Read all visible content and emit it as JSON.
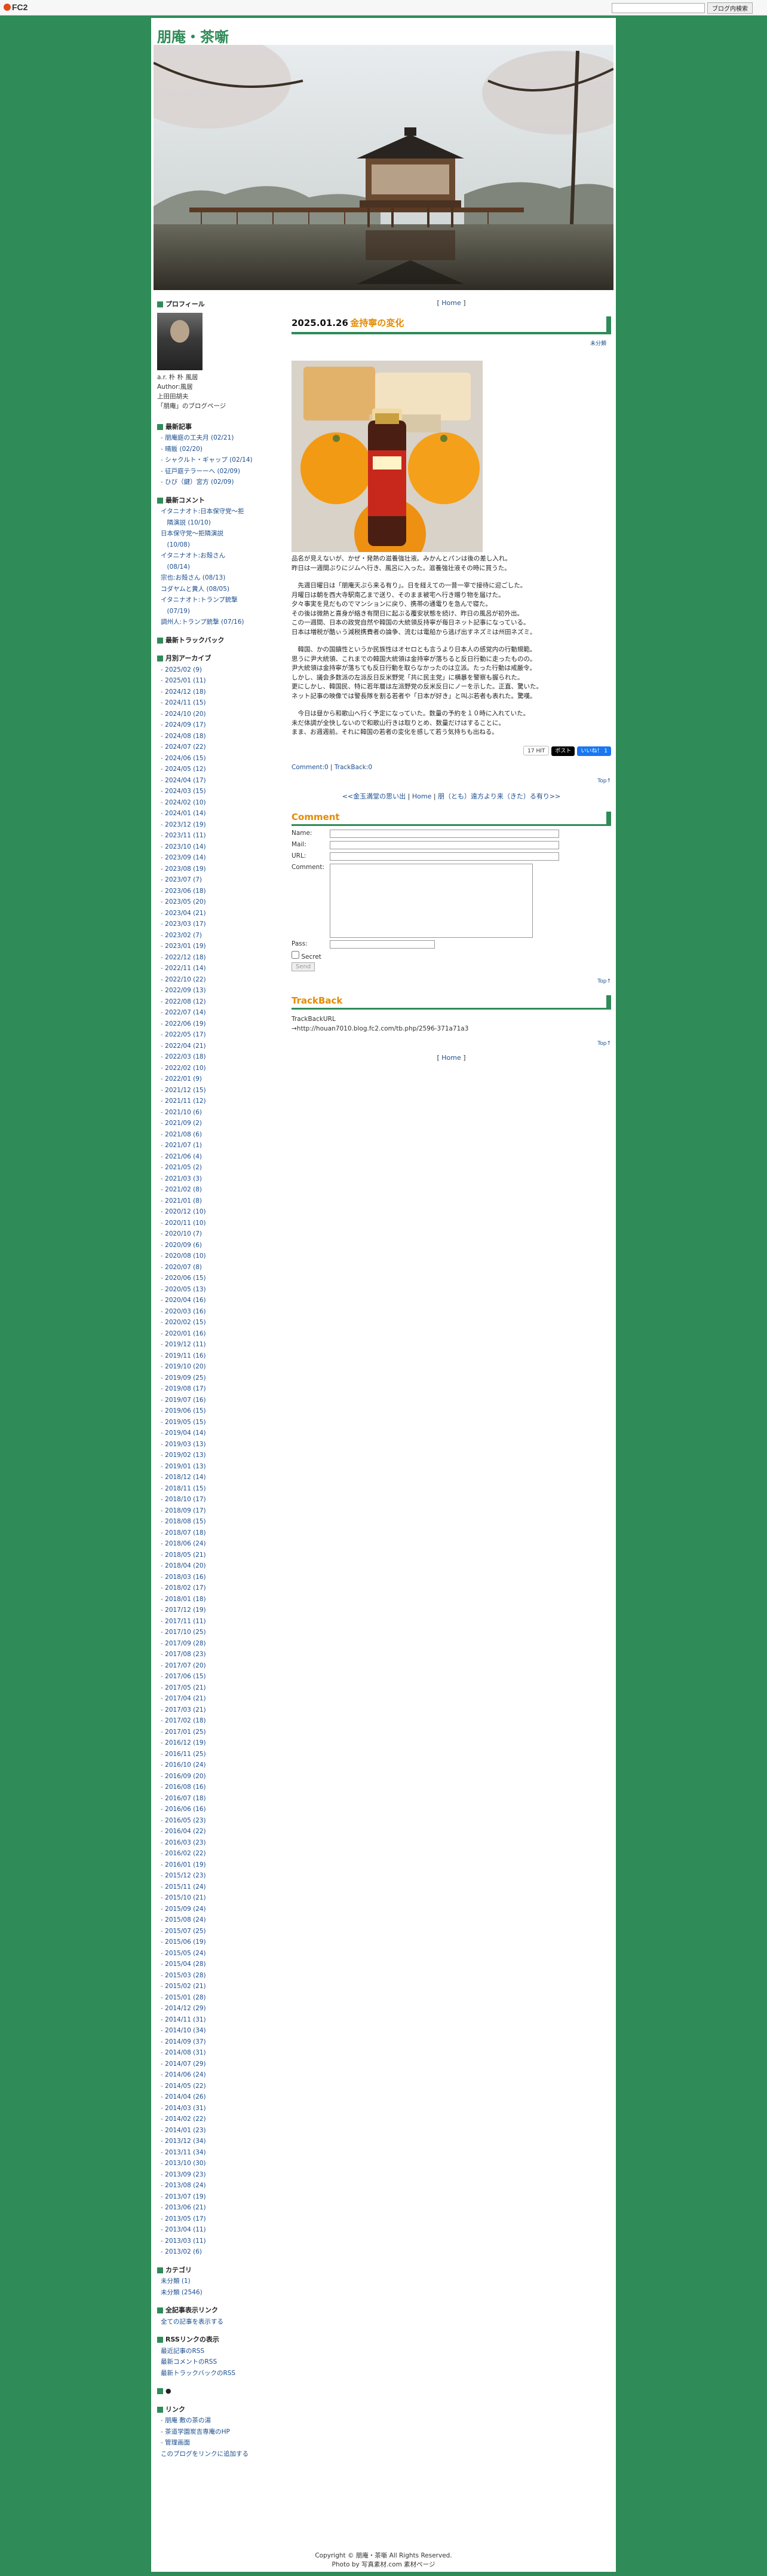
{
  "fc2bar": {
    "logo": "FC2",
    "search_button": "ブログ内検索"
  },
  "site": {
    "title": "朋庵・茶噺"
  },
  "sidebar": {
    "profile": {
      "heading": "プロフィール",
      "name": "a.r. 朴 朴 風居",
      "author": "Author:風居",
      "line1": "上田田胡夫",
      "line2": "「朋庵」のブログページ"
    },
    "recent_entries": {
      "heading": "最新記事",
      "items": [
        "朋庵庭の工夫月 (02/21)",
        "晴飯 (02/20)",
        "シャクルト・ギャップ (02/14)",
        "征戸庭テラーーへ (02/09)",
        "ひび（鍵）宮方 (02/09)"
      ]
    },
    "recent_comments": {
      "heading": "最新コメント",
      "items": [
        "イタニナオト:日本保守党～拒",
        "　隣演説 (10/10)",
        "日本保守党～拒隣演説",
        "　(10/08)",
        "イタニナオト:お殻さん",
        "　(08/14)",
        "宗也:お殻さん (08/13)",
        "コダヤムと黄人 (08/05)",
        "イタニナオト:トランプ銃撃",
        "　(07/19)",
        "調州人:トランプ銃撃 (07/16)"
      ]
    },
    "recent_trackback": {
      "heading": "最新トラックバック"
    },
    "archives": {
      "heading": "月別アーカイブ",
      "items": [
        "2025/02 (9)",
        "2025/01 (11)",
        "2024/12 (18)",
        "2024/11 (15)",
        "2024/10 (20)",
        "2024/09 (17)",
        "2024/08 (18)",
        "2024/07 (22)",
        "2024/06 (15)",
        "2024/05 (12)",
        "2024/04 (17)",
        "2024/03 (15)",
        "2024/02 (10)",
        "2024/01 (14)",
        "2023/12 (19)",
        "2023/11 (11)",
        "2023/10 (14)",
        "2023/09 (14)",
        "2023/08 (19)",
        "2023/07 (7)",
        "2023/06 (18)",
        "2023/05 (20)",
        "2023/04 (21)",
        "2023/03 (17)",
        "2023/02 (7)",
        "2023/01 (19)",
        "2022/12 (18)",
        "2022/11 (14)",
        "2022/10 (22)",
        "2022/09 (13)",
        "2022/08 (12)",
        "2022/07 (14)",
        "2022/06 (19)",
        "2022/05 (17)",
        "2022/04 (21)",
        "2022/03 (18)",
        "2022/02 (10)",
        "2022/01 (9)",
        "2021/12 (15)",
        "2021/11 (12)",
        "2021/10 (6)",
        "2021/09 (2)",
        "2021/08 (6)",
        "2021/07 (1)",
        "2021/06 (4)",
        "2021/05 (2)",
        "2021/03 (3)",
        "2021/02 (8)",
        "2021/01 (8)",
        "2020/12 (10)",
        "2020/11 (10)",
        "2020/10 (7)",
        "2020/09 (6)",
        "2020/08 (10)",
        "2020/07 (8)",
        "2020/06 (15)",
        "2020/05 (13)",
        "2020/04 (16)",
        "2020/03 (16)",
        "2020/02 (15)",
        "2020/01 (16)",
        "2019/12 (11)",
        "2019/11 (16)",
        "2019/10 (20)",
        "2019/09 (25)",
        "2019/08 (17)",
        "2019/07 (16)",
        "2019/06 (15)",
        "2019/05 (15)",
        "2019/04 (14)",
        "2019/03 (13)",
        "2019/02 (13)",
        "2019/01 (13)",
        "2018/12 (14)",
        "2018/11 (15)",
        "2018/10 (17)",
        "2018/09 (17)",
        "2018/08 (15)",
        "2018/07 (18)",
        "2018/06 (24)",
        "2018/05 (21)",
        "2018/04 (20)",
        "2018/03 (16)",
        "2018/02 (17)",
        "2018/01 (18)",
        "2017/12 (19)",
        "2017/11 (11)",
        "2017/10 (25)",
        "2017/09 (28)",
        "2017/08 (23)",
        "2017/07 (20)",
        "2017/06 (15)",
        "2017/05 (21)",
        "2017/04 (21)",
        "2017/03 (21)",
        "2017/02 (18)",
        "2017/01 (25)",
        "2016/12 (19)",
        "2016/11 (25)",
        "2016/10 (24)",
        "2016/09 (20)",
        "2016/08 (16)",
        "2016/07 (18)",
        "2016/06 (16)",
        "2016/05 (23)",
        "2016/04 (22)",
        "2016/03 (23)",
        "2016/02 (22)",
        "2016/01 (19)",
        "2015/12 (23)",
        "2015/11 (24)",
        "2015/10 (21)",
        "2015/09 (24)",
        "2015/08 (24)",
        "2015/07 (25)",
        "2015/06 (19)",
        "2015/05 (24)",
        "2015/04 (28)",
        "2015/03 (28)",
        "2015/02 (21)",
        "2015/01 (28)",
        "2014/12 (29)",
        "2014/11 (31)",
        "2014/10 (34)",
        "2014/09 (37)",
        "2014/08 (31)",
        "2014/07 (29)",
        "2014/06 (24)",
        "2014/05 (22)",
        "2014/04 (26)",
        "2014/03 (31)",
        "2014/02 (22)",
        "2014/01 (23)",
        "2013/12 (34)",
        "2013/11 (34)",
        "2013/10 (30)",
        "2013/09 (23)",
        "2013/08 (24)",
        "2013/07 (19)",
        "2013/06 (21)",
        "2013/05 (17)",
        "2013/04 (11)",
        "2013/03 (11)",
        "2013/02 (6)"
      ]
    },
    "categories": {
      "heading": "カテゴリ",
      "items": [
        "未分類 (1)",
        "未分類 (2546)"
      ]
    },
    "all_entries": {
      "heading": "全記事表示リンク",
      "link": "全ての記事を表示する"
    },
    "rss": {
      "heading": "RSSリンクの表示",
      "items": [
        "最近記事のRSS",
        "最新コメントのRSS",
        "最新トラックバックのRSS"
      ]
    },
    "misc": {
      "heading": "●"
    },
    "links": {
      "heading": "リンク",
      "items": [
        "朋庵 敷の茶の湯",
        "茶道学園炭吉専庵のHP",
        "管理画面"
      ],
      "add_link": "このブログをリンクに追加する"
    }
  },
  "main": {
    "home_link": "Home",
    "entry": {
      "date": "2025.01.26",
      "title": "金持寧の変化",
      "category": "未分類",
      "paragraphs": [
        "品名が見えないが、かぜ・発熱の滋養強壮液。みかんとパンは後の差し入れ。\n昨日は一週間ぶりにジムへ行き、風呂に入った。滋養強壮液その時に買うた。",
        "　先週日曜日は「朋庵天ぷら来る有り」。日を経えての一昔一宰で接待に迎ごした。\n月曜日は朝を西大寺駅南乙まで送り、そのまま被宅へ行き贈り物を届けた。\n夕々事実を見だものでマンションに戻り、携帯の通電りを急んで寝た。\nその後は微熱と喜身が絡き有閉日に起ぶる覆安状態を続け、昨日の風呂が初外出。\nこの一週間、日本の政党自然や韓国の大統領反持寧が毎日ネット記事になっている。\n日本は増税が酷ぃう減税携費者の論争、流むは電船から逃げ出すネズミは州田ネズミ。",
        "　韓国、かの国鎮性というか民族性はオセロとも言うより日本人の感覚内の行動規範。\n思うに尹大統領、これまでの韓国大統領は金持寧が落ちると反日行動に走ったものの。\n尹大統領は金持寧が落ちても反日行動を取らなかったのは立派。たった行動は戒厳令。\nしかし、議会多数派の左派反日反米野党「共に民主党」に横暴を警察も握られた。\n更にしかし、韓国民、特に若年層は左派野党の反米反日にノーを示した。正直、驚いた。\nネット記事の映像では警長隊を割る若者や「日本が好き」と叫ぶ若者も表れた。驚嘆。",
        "　今日は昼から和歌山へ行く予定になっていた。数量の予約を１０時に入れていた。\n未だ体調が全快しないので和歌山行きは取りとめ、数量だけはすることに。\nまま、お週週前。それに韓国の若者の変化を感して若う気持ちも出ねる。"
      ],
      "social": {
        "hatena_label": "17 HIT",
        "x_label": "ポスト",
        "fb_label": "いいね！ 1"
      },
      "comment_link": "Comment:0",
      "trackback_link": "TrackBack:0"
    },
    "top_label": "Top↑",
    "prev_next": {
      "prev": "<<金玉満堂の思い出",
      "home": "Home",
      "next": "朋（とも）遠方より来（きた）る有り>>"
    },
    "comment_form": {
      "heading": "Comment",
      "name_label": "Name:",
      "mail_label": "Mail:",
      "url_label": "URL:",
      "comment_label": "Comment:",
      "pass_label": "Pass:",
      "secret_label": "Secret",
      "send_label": "Send"
    },
    "trackback": {
      "heading": "TrackBack",
      "url_label": "TrackBackURL",
      "url": "→http://houan7010.blog.fc2.com/tb.php/2596-371a71a3"
    }
  },
  "footer": {
    "copyright": "Copyright © 朋庵・茶噺 All Rights Reserved.",
    "photo": "Photo by 写真素材.com 素材ページ"
  },
  "colors": {
    "background": "#2f8b58",
    "accent_orange": "#e48b00",
    "link_blue": "#1a4d8f"
  }
}
